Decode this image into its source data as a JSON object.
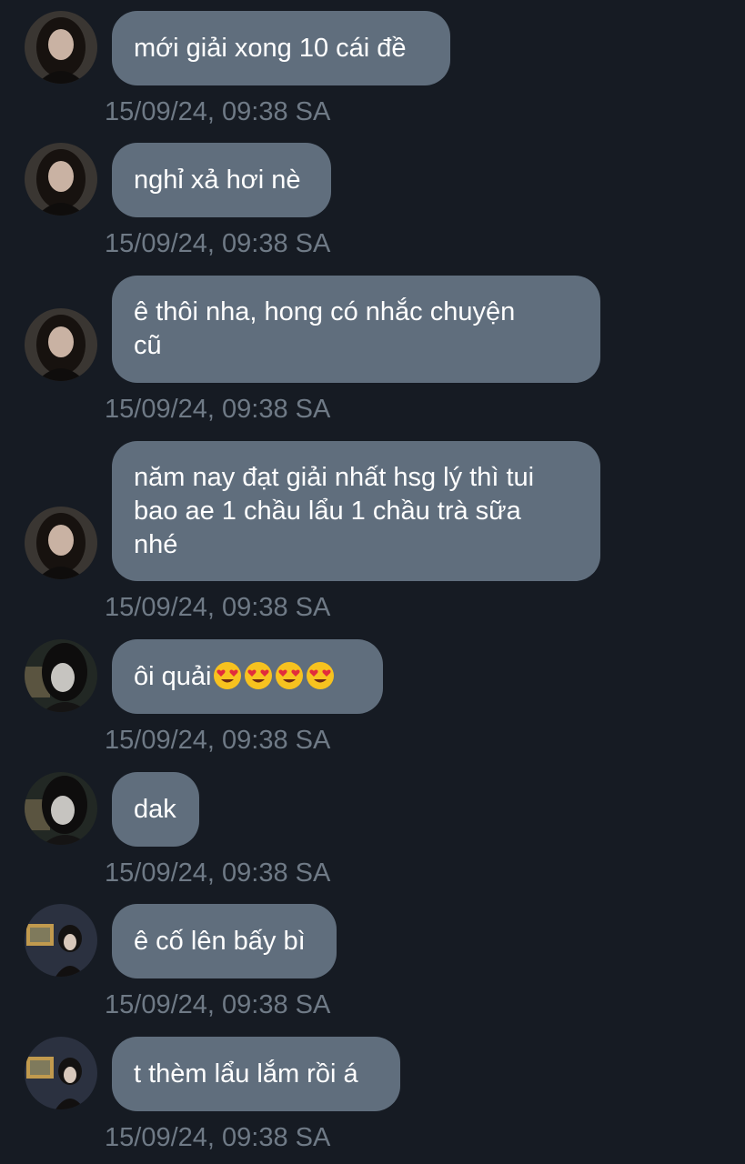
{
  "messages": [
    {
      "sender": "user-a",
      "text": "mới giải xong 10 cái đề",
      "time": "15/09/24, 09:38 SA"
    },
    {
      "sender": "user-a",
      "text": "nghỉ xả hơi nè",
      "time": "15/09/24, 09:38 SA"
    },
    {
      "sender": "user-a",
      "text": "ê thôi nha, hong có nhắc chuyện\ncũ",
      "time": "15/09/24, 09:38 SA"
    },
    {
      "sender": "user-a",
      "text": "năm nay đạt giải nhất hsg lý thì tui\nbao ae 1 chầu lẩu 1 chầu trà sữa\nnhé",
      "time": "15/09/24, 09:38 SA"
    },
    {
      "sender": "user-b",
      "text": "ôi quải",
      "emojis": [
        "heart-eyes-emoji",
        "heart-eyes-emoji",
        "heart-eyes-emoji",
        "heart-eyes-emoji"
      ],
      "time": "15/09/24, 09:38 SA"
    },
    {
      "sender": "user-b",
      "text": "dak",
      "time": "15/09/24, 09:38 SA"
    },
    {
      "sender": "user-c",
      "text": "ê cố lên bấy bì",
      "time": "15/09/24, 09:38 SA"
    },
    {
      "sender": "user-c",
      "text": "t thèm lẩu lắm rồi á",
      "time": "15/09/24, 09:38 SA"
    }
  ],
  "colors": {
    "background": "#161b23",
    "bubble": "#606e7d",
    "bubble_text": "#ffffff",
    "timestamp": "#6f7a86"
  }
}
